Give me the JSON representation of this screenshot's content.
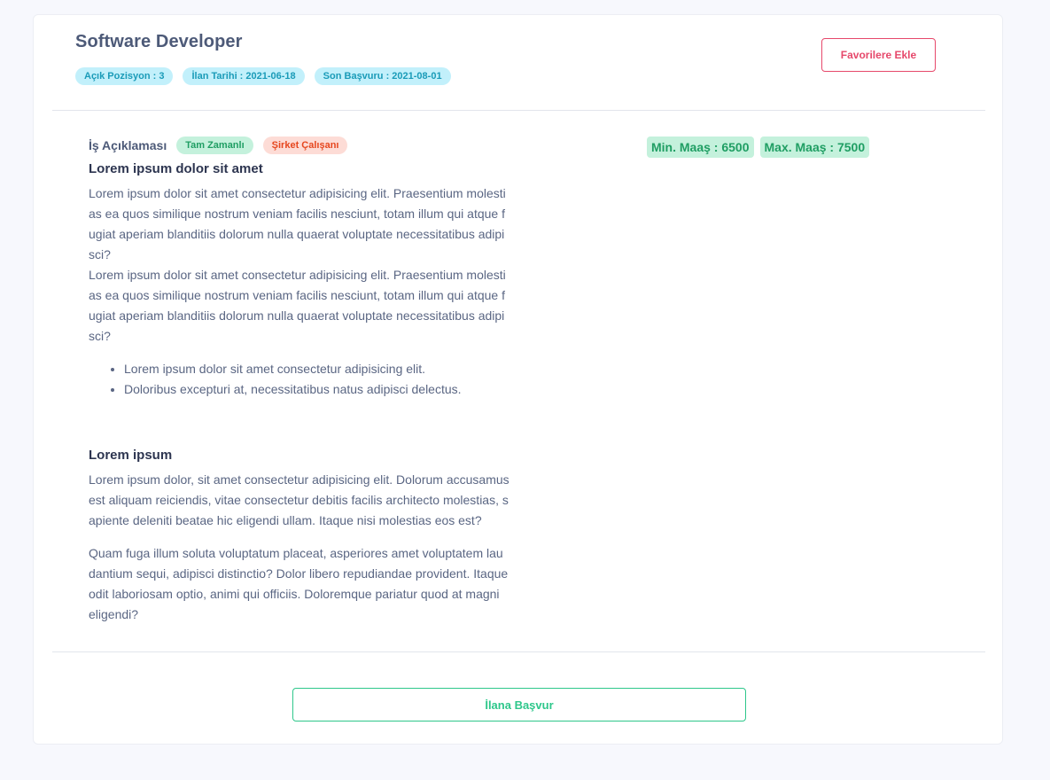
{
  "job": {
    "title": "Software Developer",
    "badges": {
      "open_positions": "Açık Pozisyon : 3",
      "listing_date": "İlan Tarihi : 2021-06-18",
      "deadline": "Son Başvuru : 2021-08-01"
    },
    "favorite_button": "Favorilere Ekle"
  },
  "description": {
    "label": "İş Açıklaması",
    "employment_type": "Tam Zamanlı",
    "employee_type": "Şirket Çalışanı",
    "section1": {
      "title": "Lorem ipsum dolor sit amet",
      "paragraphs": [
        "Lorem ipsum dolor sit amet consectetur adipisicing elit. Praesentium molestias ea quos similique nostrum veniam facilis nesciunt, totam illum qui atque fugiat aperiam blanditiis dolorum nulla quaerat voluptate necessitatibus adipisci?",
        "Lorem ipsum dolor sit amet consectetur adipisicing elit. Praesentium molestias ea quos similique nostrum veniam facilis nesciunt, totam illum qui atque fugiat aperiam blanditiis dolorum nulla quaerat voluptate necessitatibus adipisci?"
      ],
      "bullets": [
        "Lorem ipsum dolor sit amet consectetur adipisicing elit.",
        "Doloribus excepturi at, necessitatibus natus adipisci delectus."
      ]
    },
    "section2": {
      "title": "Lorem ipsum",
      "paragraphs": [
        "Lorem ipsum dolor, sit amet consectetur adipisicing elit. Dolorum accusamus est aliquam reiciendis, vitae consectetur debitis facilis architecto molestias, sapiente deleniti beatae hic eligendi ullam. Itaque nisi molestias eos est?",
        "Quam fuga illum soluta voluptatum placeat, asperiores amet voluptatem laudantium sequi, adipisci distinctio? Dolor libero repudiandae provident. Itaque odit laboriosam optio, animi qui officiis. Doloremque pariatur quod at magni eligendi?"
      ]
    }
  },
  "salary": {
    "min": "Min. Maaş : 6500",
    "max": "Max. Maaş : 7500"
  },
  "apply_button": "İlana Başvur",
  "colors": {
    "background": "#f7f8fd",
    "accent_green": "#2ec78b",
    "accent_red": "#e6486b",
    "badge_cyan": "#c2f0fb",
    "badge_green": "#c4f1dc",
    "badge_red": "#fddcd6"
  }
}
